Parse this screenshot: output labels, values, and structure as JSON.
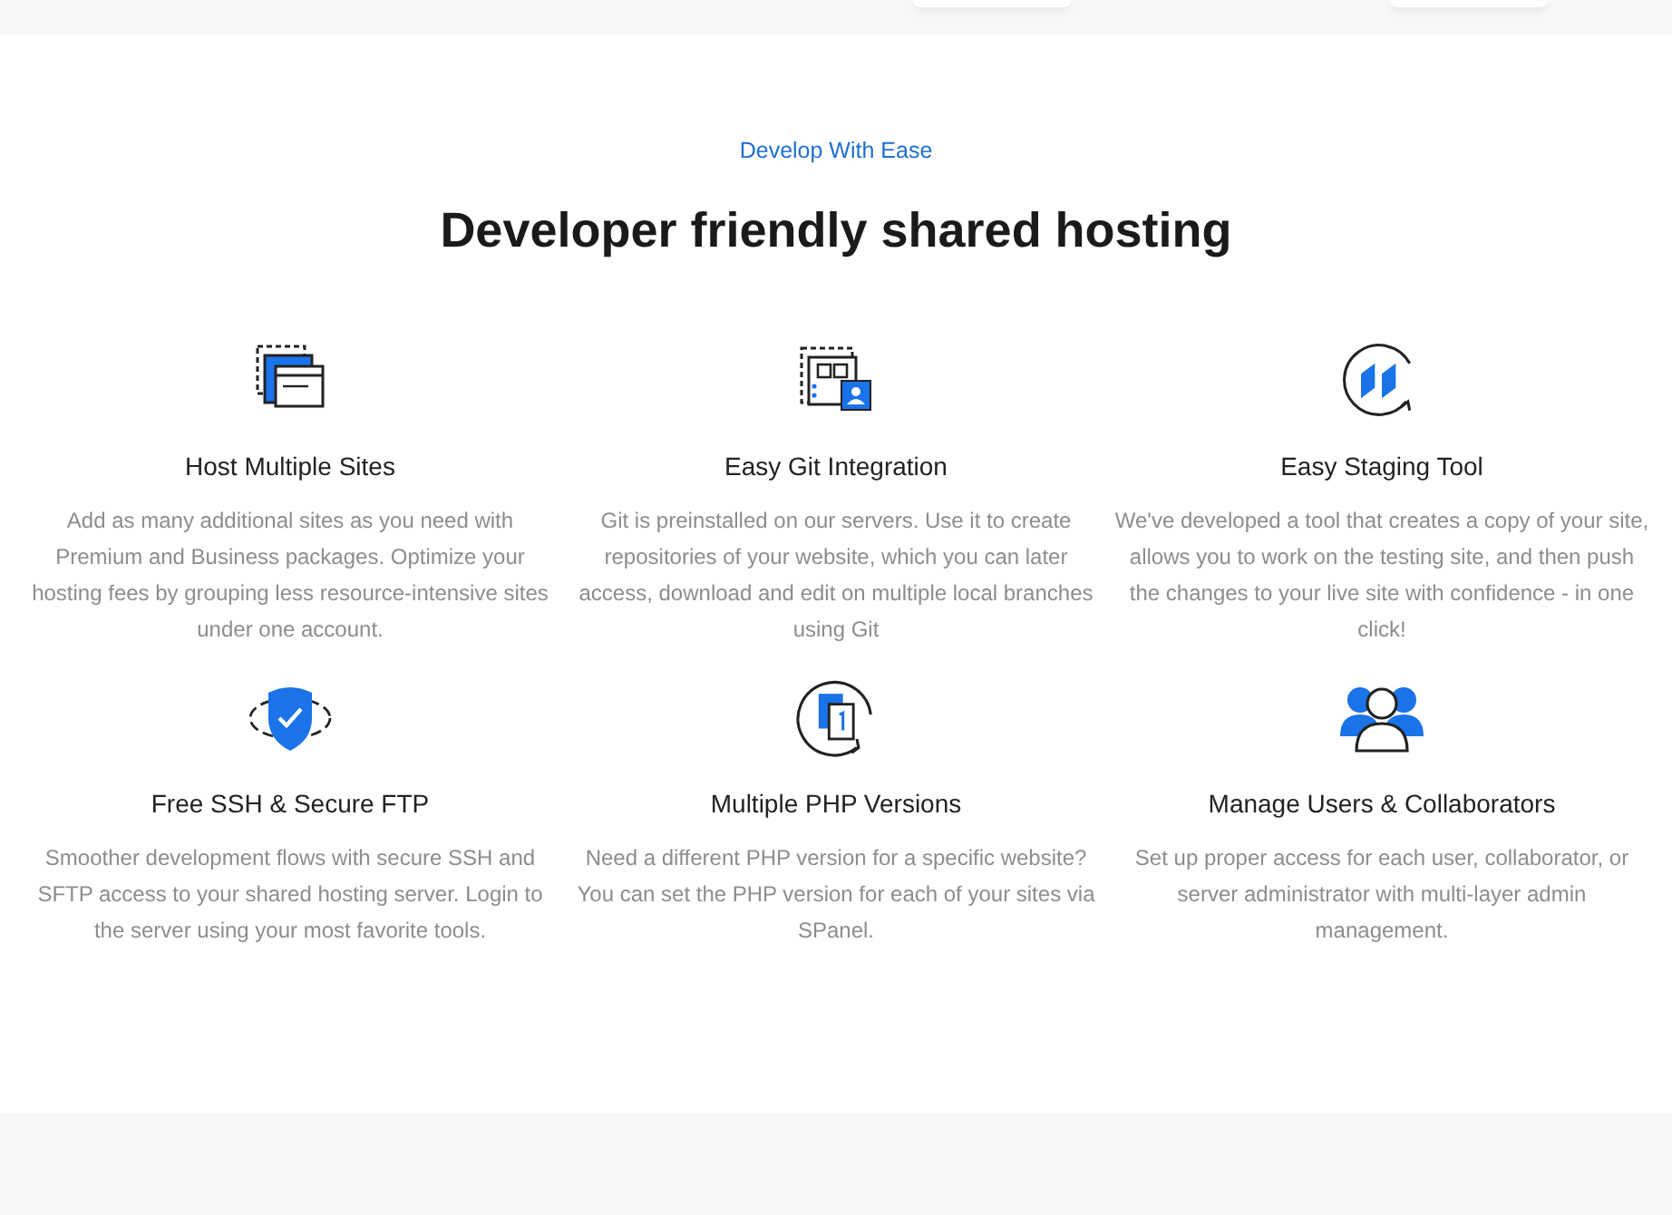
{
  "section": {
    "kicker": "Develop With Ease",
    "title": "Developer friendly shared hosting"
  },
  "features": [
    {
      "title": "Host Multiple Sites",
      "description": "Add as many additional sites as you need with Premium and Business packages. Optimize your hosting fees by grouping less resource-intensive sites under one account."
    },
    {
      "title": "Easy Git Integration",
      "description": "Git is preinstalled on our servers. Use it to create repositories of your website, which you can later access, download and edit on multiple local branches using Git"
    },
    {
      "title": "Easy Staging Tool",
      "description": "We've developed a tool that creates a copy of your site, allows you to work on the testing site, and then push the changes to your live site with confidence - in one click!"
    },
    {
      "title": "Free SSH & Secure FTP",
      "description": "Smoother development flows with secure SSH and SFTP access to your shared hosting server. Login to the server using your most favorite tools."
    },
    {
      "title": "Multiple PHP Versions",
      "description": "Need a different PHP version for a specific website? You can set the PHP version for each of your sites via SPanel."
    },
    {
      "title": "Manage Users & Collaborators",
      "description": "Set up proper access for each user, collaborator, or server administrator with multi-layer admin management."
    }
  ]
}
